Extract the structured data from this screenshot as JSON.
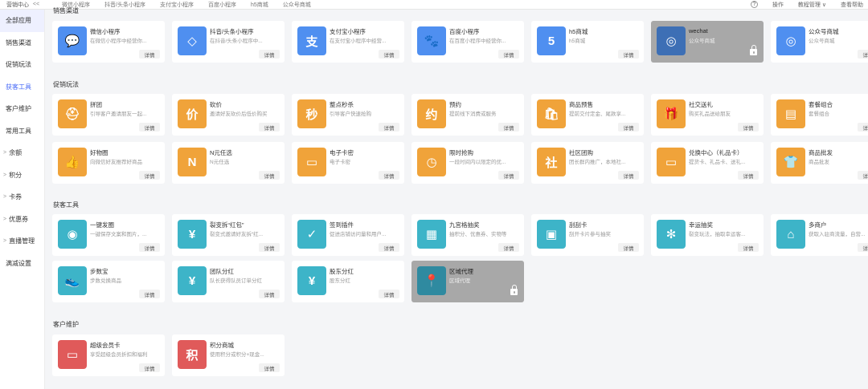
{
  "topbar": {
    "brand": "营销中心",
    "collapse": "<<",
    "tabs": [
      "微信小程序",
      "抖音/头条小程序",
      "支付宝小程序",
      "百度小程序",
      "h5商城",
      "公众号商城"
    ],
    "help": "?",
    "right": [
      "操作",
      "教程管理 ∨",
      "查看帮助"
    ]
  },
  "sidebar": [
    {
      "label": "全部应用",
      "arrow": ""
    },
    {
      "label": "销售渠道",
      "arrow": ""
    },
    {
      "label": "促销玩法",
      "arrow": ""
    },
    {
      "label": "获客工具",
      "arrow": ""
    },
    {
      "label": "客户维护",
      "arrow": ""
    },
    {
      "label": "常用工具",
      "arrow": ""
    },
    {
      "label": "余额",
      "arrow": ">"
    },
    {
      "label": "积分",
      "arrow": ">"
    },
    {
      "label": "卡券",
      "arrow": ">"
    },
    {
      "label": "优惠券",
      "arrow": ">"
    },
    {
      "label": "直播管理",
      "arrow": ">"
    },
    {
      "label": "满减设置",
      "arrow": ""
    }
  ],
  "sections": {
    "channels": "销售渠道",
    "promo": "促销玩法",
    "acquire": "获客工具",
    "retain": "客户维护"
  },
  "detail_label": "详情",
  "cards": {
    "channels": [
      {
        "name": "微信小程序",
        "desc": "在微信小程序中经营你...",
        "icon": "wechat-icon",
        "glyph": "💬",
        "color": "#4f8ff0"
      },
      {
        "name": "抖音/头条小程序",
        "desc": "在抖音/头条小程序中...",
        "icon": "douyin-icon",
        "glyph": "◇",
        "color": "#4f8ff0"
      },
      {
        "name": "支付宝小程序",
        "desc": "在支付宝小程序中经营...",
        "icon": "alipay-icon",
        "glyph": "支",
        "color": "#4f8ff0"
      },
      {
        "name": "百度小程序",
        "desc": "在百度小程序中经营你...",
        "icon": "baidu-icon",
        "glyph": "🐾",
        "color": "#4f8ff0"
      },
      {
        "name": "h5商城",
        "desc": "h5商城",
        "icon": "html5-icon",
        "glyph": "5",
        "color": "#4f8ff0"
      },
      {
        "name": "wechat",
        "desc": "公众号商城",
        "icon": "official-account-icon",
        "glyph": "◎",
        "color": "#3d6fb5",
        "disabled": true
      },
      {
        "name": "公众号商城",
        "desc": "公众号商城",
        "icon": "official-account-icon",
        "glyph": "◎",
        "color": "#4f8ff0"
      }
    ],
    "promo_row1": [
      {
        "name": "拼团",
        "desc": "引导客户邀请朋友一起...",
        "icon": "group-buy-icon",
        "glyph": "⛑",
        "color": "#f0a33a"
      },
      {
        "name": "砍价",
        "desc": "邀请好友砍价后低价购买",
        "icon": "bargain-icon",
        "glyph": "价",
        "color": "#f0a33a"
      },
      {
        "name": "整点秒杀",
        "desc": "引导客户快速抢购",
        "icon": "flash-sale-icon",
        "glyph": "秒",
        "color": "#f0a33a"
      },
      {
        "name": "预约",
        "desc": "提前线下消费或服务",
        "icon": "appointment-icon",
        "glyph": "约",
        "color": "#f0a33a"
      },
      {
        "name": "商品预售",
        "desc": "提前交付定金、尾款享...",
        "icon": "presale-icon",
        "glyph": "🛍",
        "color": "#f0a33a"
      },
      {
        "name": "社交送礼",
        "desc": "购买礼品送给朋友",
        "icon": "gift-icon",
        "glyph": "🎁",
        "color": "#f0a33a"
      },
      {
        "name": "套餐组合",
        "desc": "套餐组合",
        "icon": "combo-icon",
        "glyph": "▤",
        "color": "#f0a33a"
      }
    ],
    "promo_row2": [
      {
        "name": "好物圈",
        "desc": "向微信好友推荐好商品",
        "icon": "recommend-icon",
        "glyph": "👍",
        "color": "#f0a33a"
      },
      {
        "name": "N元任选",
        "desc": "N元任选",
        "icon": "n-yuan-icon",
        "glyph": "N",
        "color": "#f0a33a"
      },
      {
        "name": "电子卡密",
        "desc": "电子卡密",
        "icon": "ecard-icon",
        "glyph": "▭",
        "color": "#f0a33a"
      },
      {
        "name": "限时抢购",
        "desc": "一段时间内以限定的优...",
        "icon": "limited-time-icon",
        "glyph": "◷",
        "color": "#f0a33a"
      },
      {
        "name": "社区团购",
        "desc": "团长群内推广，本地社...",
        "icon": "community-icon",
        "glyph": "社",
        "color": "#f0a33a"
      },
      {
        "name": "兑换中心（礼品卡）",
        "desc": "提货卡、礼品卡、送礼...",
        "icon": "gift-card-icon",
        "glyph": "▭",
        "color": "#f0a33a"
      },
      {
        "name": "商品批发",
        "desc": "商品批发",
        "icon": "wholesale-icon",
        "glyph": "👕",
        "color": "#f0a33a"
      }
    ],
    "acquire_row1": [
      {
        "name": "一键发圈",
        "desc": "一键保存文案和图片，...",
        "icon": "moments-icon",
        "glyph": "◉",
        "color": "#3db4c8"
      },
      {
        "name": "裂变拆“红包”",
        "desc": "裂变式邀请好友拆“红...",
        "icon": "red-packet-icon",
        "glyph": "¥",
        "color": "#3db4c8"
      },
      {
        "name": "签到插件",
        "desc": "促进店铺访问量和用户...",
        "icon": "checkin-icon",
        "glyph": "✓",
        "color": "#3db4c8"
      },
      {
        "name": "九宫格抽奖",
        "desc": "抽积分、优惠券、实物等",
        "icon": "grid-lottery-icon",
        "glyph": "▦",
        "color": "#3db4c8"
      },
      {
        "name": "刮刮卡",
        "desc": "刮开卡片参与抽奖",
        "icon": "scratch-card-icon",
        "glyph": "▣",
        "color": "#3db4c8"
      },
      {
        "name": "幸运抽奖",
        "desc": "裂变玩法，抽取幸运客...",
        "icon": "lucky-wheel-icon",
        "glyph": "✻",
        "color": "#3db4c8"
      },
      {
        "name": "多商户",
        "desc": "获取入驻商流量，自营...",
        "icon": "multi-store-icon",
        "glyph": "⌂",
        "color": "#3db4c8"
      }
    ],
    "acquire_row2": [
      {
        "name": "步数宝",
        "desc": "步数兑换商品",
        "icon": "steps-icon",
        "glyph": "👟",
        "color": "#3db4c8"
      },
      {
        "name": "团队分红",
        "desc": "队长获得队员订单分红",
        "icon": "team-bonus-icon",
        "glyph": "¥",
        "color": "#3db4c8"
      },
      {
        "name": "股东分红",
        "desc": "股东分红",
        "icon": "shareholder-icon",
        "glyph": "¥",
        "color": "#3db4c8"
      },
      {
        "name": "区域代理",
        "desc": "区域代理",
        "icon": "region-agent-icon",
        "glyph": "📍",
        "color": "#2f8aa0",
        "disabled": true
      }
    ],
    "retain_row": [
      {
        "name": "超级会员卡",
        "desc": "享受超级会员折扣和福利",
        "icon": "vip-card-icon",
        "glyph": "▭",
        "color": "#e05a5a"
      },
      {
        "name": "积分商城",
        "desc": "使用积分或积分+现金...",
        "icon": "points-mall-icon",
        "glyph": "积",
        "color": "#e05a5a"
      }
    ]
  }
}
